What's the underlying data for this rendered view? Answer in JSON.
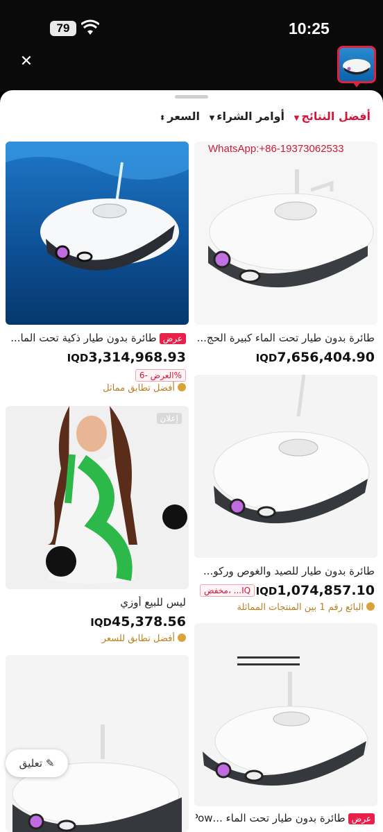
{
  "status": {
    "battery": "79",
    "time": "10:25"
  },
  "sort": [
    {
      "label": "أفضل النتائج",
      "active": true
    },
    {
      "label": "أوامر الشراء",
      "active": false
    },
    {
      "label": "السعر",
      "active": false
    }
  ],
  "products": [
    {
      "title": "طائرة بدون طيار تحت الماء كبيرة الحج...",
      "price_currency": "IQD",
      "price_value": "7,656,404.90",
      "watermark": "WhatsApp:+86-19373062533"
    },
    {
      "badge": "عرض",
      "title": "طائرة بدون طيار ذكية تحت الما...",
      "price_currency": "IQD",
      "price_value": "3,314,968.93",
      "deal": "العرض -6%",
      "match": "أفضل تطابق مماثل"
    },
    {
      "title": "طائرة بدون طيار للصيد والغوص وركو...",
      "price_currency": "IQD",
      "price_value": "1,074,857.10",
      "deal": "مخفض، ...IQ",
      "match": "البائع رقم 1 بين المنتجات المماثلة"
    },
    {
      "ad": "إعلان",
      "title": "ليس للبيع أوزي",
      "price_currency": "IQD",
      "price_value": "45,378.56",
      "match": "أفضل تطابق للسعر"
    },
    {
      "badge": "عرض",
      "title": "طائرة بدون طيار تحت الماء ...Pow"
    }
  ],
  "comment_label": "تعليق"
}
